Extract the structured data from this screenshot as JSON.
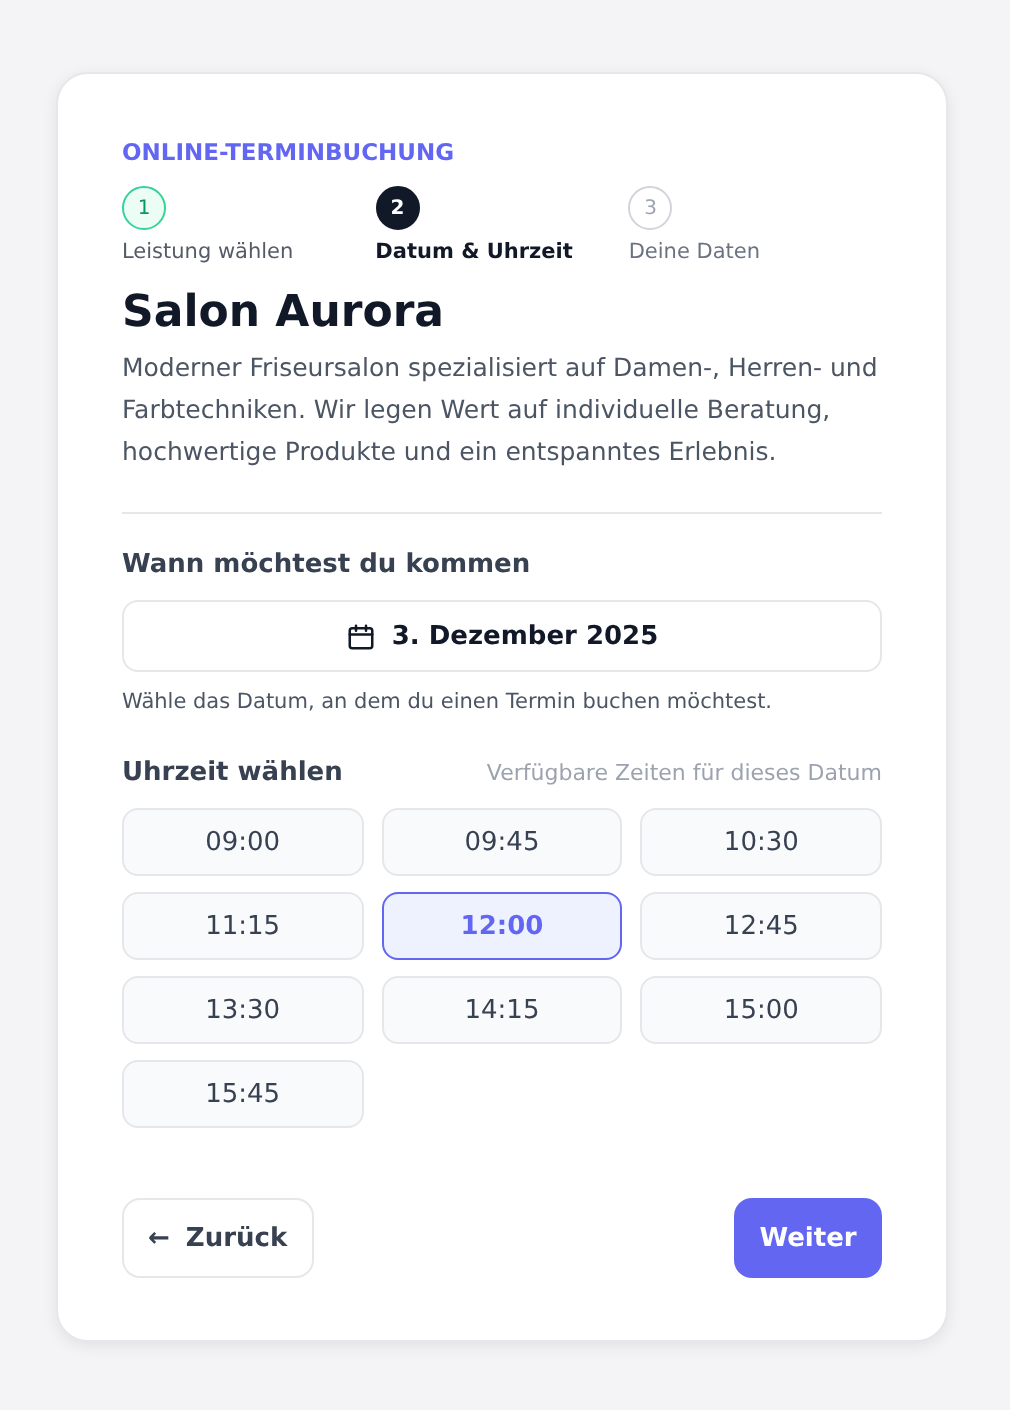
{
  "eyebrow": "ONLINE-TERMINBUCHUNG",
  "steps": [
    {
      "number": "1",
      "label": "Leistung wählen",
      "kind": "done"
    },
    {
      "number": "2",
      "label": "Datum & Uhrzeit",
      "kind": "current"
    },
    {
      "number": "3",
      "label": "Deine Daten",
      "kind": "upcoming"
    }
  ],
  "salon": {
    "name": "Salon Aurora",
    "description": "Moderner Friseursalon spezialisiert auf Damen-, Herren- und Farbtechniken. Wir legen Wert auf individuelle Beratung, hochwertige Produkte und ein entspanntes Erlebnis."
  },
  "date_section": {
    "label": "Wann möchtest du kommen",
    "value": "3. Dezember 2025",
    "hint": "Wähle das Datum, an dem du einen Termin buchen möchtest."
  },
  "time_section": {
    "label": "Uhrzeit wählen",
    "note": "Verfügbare Zeiten für dieses Datum",
    "slots": [
      {
        "time": "09:00",
        "selected": false
      },
      {
        "time": "09:45",
        "selected": false
      },
      {
        "time": "10:30",
        "selected": false
      },
      {
        "time": "11:15",
        "selected": false
      },
      {
        "time": "12:00",
        "selected": true
      },
      {
        "time": "12:45",
        "selected": false
      },
      {
        "time": "13:30",
        "selected": false
      },
      {
        "time": "14:15",
        "selected": false
      },
      {
        "time": "15:00",
        "selected": false
      },
      {
        "time": "15:45",
        "selected": false
      }
    ]
  },
  "back_button": {
    "arrow": "←",
    "label": "Zurück"
  },
  "next_button": {
    "label": "Weiter"
  }
}
